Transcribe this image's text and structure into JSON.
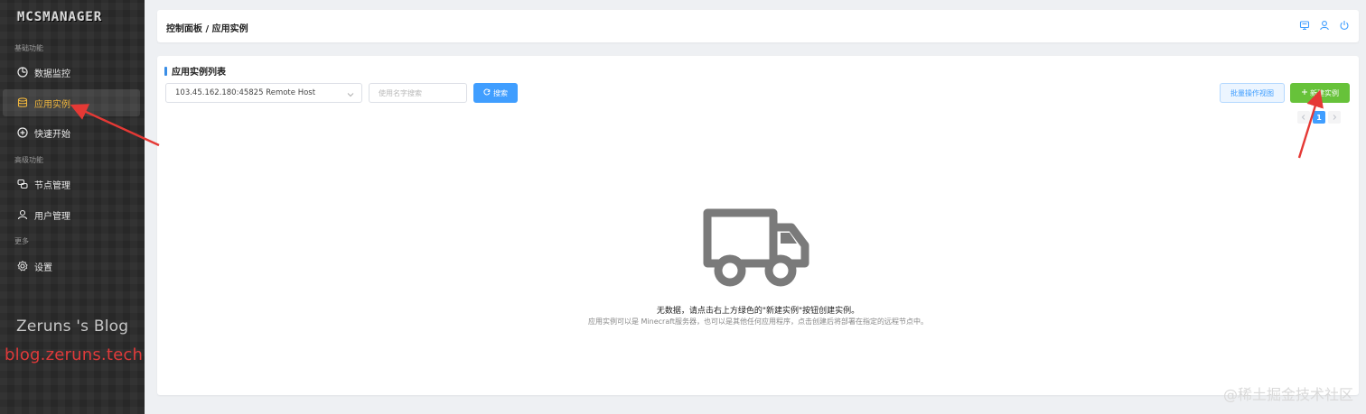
{
  "sidebar": {
    "logo": "MCSMANAGER",
    "groups": {
      "basic": "基础功能",
      "advanced": "高级功能",
      "more": "更多"
    },
    "items": [
      {
        "label": "数据监控",
        "icon": "dashboard-icon"
      },
      {
        "label": "应用实例",
        "icon": "database-icon",
        "active": true
      },
      {
        "label": "快速开始",
        "icon": "plus-circle-icon"
      },
      {
        "label": "节点管理",
        "icon": "nodes-icon"
      },
      {
        "label": "用户管理",
        "icon": "user-icon"
      },
      {
        "label": "设置",
        "icon": "gear-icon"
      }
    ],
    "watermark_line1": "Zeruns 's Blog",
    "watermark_line2": "blog.zeruns.tech"
  },
  "header": {
    "breadcrumb": "控制面板 / 应用实例",
    "icons": [
      "monitor-icon",
      "user-icon",
      "power-icon"
    ]
  },
  "main": {
    "section_title": "应用实例列表",
    "node_select": {
      "value": "103.45.162.180:45825 Remote Host"
    },
    "search": {
      "placeholder": "使用名字搜索",
      "button_label": "搜索"
    },
    "batch_button": "批量操作视图",
    "new_button": "新建实例",
    "pagination": {
      "current_page": "1"
    },
    "empty": {
      "title": "无数据，请点击右上方绿色的\"新建实例\"按钮创建实例。",
      "subtitle": "应用实例可以是 Minecraft服务器，也可以是其他任何应用程序，点击创建后将部署在指定的远程节点中。"
    }
  },
  "colors": {
    "primary": "#409eff",
    "success": "#67c23a",
    "sidebar_bg": "#2a2a2a",
    "active_text": "#f0b63d",
    "annotation_arrow": "#e53935"
  },
  "corner_watermark": "@稀土掘金技术社区"
}
